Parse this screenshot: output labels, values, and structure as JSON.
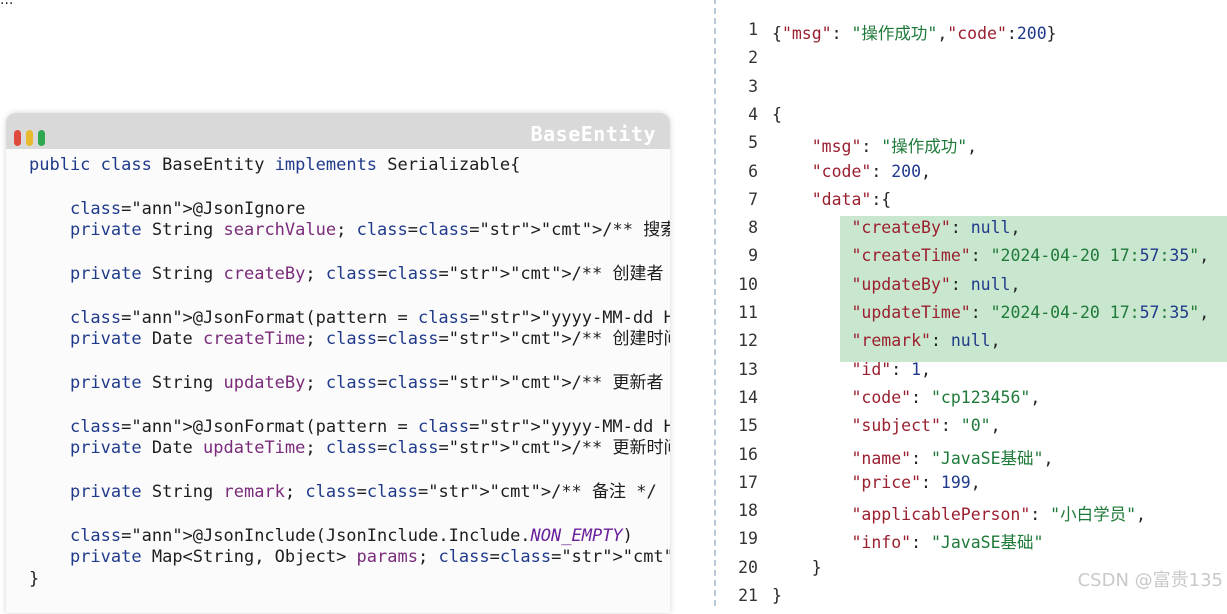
{
  "card": {
    "title": "BaseEntity",
    "lines": [
      "public class BaseEntity implements Serializable{",
      "",
      "    @JsonIgnore",
      "    private String searchValue; /** 搜索值 */",
      "",
      "    private String createBy; /** 创建者 */",
      "",
      "    @JsonFormat(pattern = \"yyyy-MM-dd HH:mm:ss\")",
      "    private Date createTime; /** 创建时间 */",
      "",
      "    private String updateBy; /** 更新者 */",
      "",
      "    @JsonFormat(pattern = \"yyyy-MM-dd HH:mm:ss\")",
      "    private Date updateTime; /** 更新时间 */",
      "",
      "    private String remark; /** 备注 */",
      "",
      "    @JsonInclude(JsonInclude.Include.NON_EMPTY)",
      "    private Map<String, Object> params; /** 请求参数*/",
      "}"
    ]
  },
  "json_panel": {
    "lines": [
      {
        "num": "1",
        "text": "{\"msg\":\"操作成功\",\"code\":200}"
      },
      {
        "num": "2",
        "text": ""
      },
      {
        "num": "3",
        "text": ""
      },
      {
        "num": "4",
        "text": "{"
      },
      {
        "num": "5",
        "text": "    \"msg\": \"操作成功\","
      },
      {
        "num": "6",
        "text": "    \"code\": 200,"
      },
      {
        "num": "7",
        "text": "    \"data\":{"
      },
      {
        "num": "8",
        "text": "        \"createBy\": null,"
      },
      {
        "num": "9",
        "text": "        \"createTime\": \"2024-04-20 17:57:35\","
      },
      {
        "num": "10",
        "text": "        \"updateBy\": null,"
      },
      {
        "num": "11",
        "text": "        \"updateTime\": \"2024-04-20 17:57:35\","
      },
      {
        "num": "12",
        "text": "        \"remark\": null,"
      },
      {
        "num": "13",
        "text": "        \"id\": 1,"
      },
      {
        "num": "14",
        "text": "        \"code\": \"cp123456\","
      },
      {
        "num": "15",
        "text": "        \"subject\": \"0\","
      },
      {
        "num": "16",
        "text": "        \"name\": \"JavaSE基础\","
      },
      {
        "num": "17",
        "text": "        \"price\": 199,"
      },
      {
        "num": "18",
        "text": "        \"applicablePerson\": \"小白学员\","
      },
      {
        "num": "19",
        "text": "        \"info\": \"JavaSE基础\""
      },
      {
        "num": "20",
        "text": "    }"
      },
      {
        "num": "21",
        "text": "}"
      }
    ]
  },
  "watermark": "CSDN @富贵135",
  "corner_text": "...",
  "colors": {
    "highlight": "#bfe3c6",
    "header": "#d9d9d9"
  }
}
